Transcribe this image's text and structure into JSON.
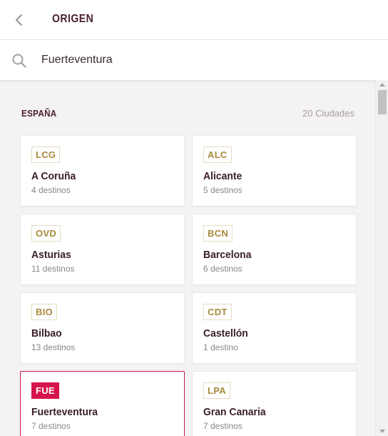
{
  "header": {
    "title": "ORIGEN",
    "back_icon": "chevron-left-icon"
  },
  "search": {
    "icon": "search-icon",
    "value": "Fuerteventura"
  },
  "section": {
    "title": "ESPAÑA",
    "count": "20 Ciudades"
  },
  "cities": [
    {
      "code": "LCG",
      "name": "A Coruña",
      "destinations": "4 destinos",
      "selected": false
    },
    {
      "code": "ALC",
      "name": "Alicante",
      "destinations": "5 destinos",
      "selected": false
    },
    {
      "code": "OVD",
      "name": "Asturias",
      "destinations": "11 destinos",
      "selected": false
    },
    {
      "code": "BCN",
      "name": "Barcelona",
      "destinations": "6 destinos",
      "selected": false
    },
    {
      "code": "BIO",
      "name": "Bilbao",
      "destinations": "13 destinos",
      "selected": false
    },
    {
      "code": "CDT",
      "name": "Castellón",
      "destinations": "1 destino",
      "selected": false
    },
    {
      "code": "FUE",
      "name": "Fuerteventura",
      "destinations": "7 destinos",
      "selected": true
    },
    {
      "code": "LPA",
      "name": "Gran Canaria",
      "destinations": "7 destinos",
      "selected": false
    }
  ],
  "colors": {
    "accent": "#d6144c",
    "code_text": "#a88a3a",
    "title": "#4a1f2a"
  }
}
